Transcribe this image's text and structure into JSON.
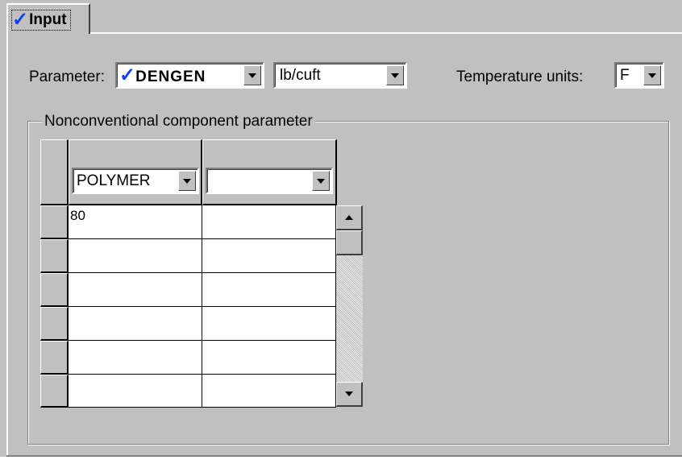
{
  "tab": {
    "label": "Input",
    "checked": true
  },
  "parameter": {
    "label": "Parameter:",
    "value": "DENGEN",
    "units_value": "lb/cuft"
  },
  "temperature": {
    "label": "Temperature units:",
    "value": "F"
  },
  "group": {
    "title": "Nonconventional component parameter"
  },
  "grid": {
    "columns": [
      {
        "component": "POLYMER"
      },
      {
        "component": ""
      }
    ],
    "rows": [
      [
        "80",
        ""
      ],
      [
        "",
        ""
      ],
      [
        "",
        ""
      ],
      [
        "",
        ""
      ],
      [
        "",
        ""
      ],
      [
        "",
        ""
      ]
    ]
  },
  "colors": {
    "face": "#c0c0c0",
    "check": "#1040ff"
  }
}
